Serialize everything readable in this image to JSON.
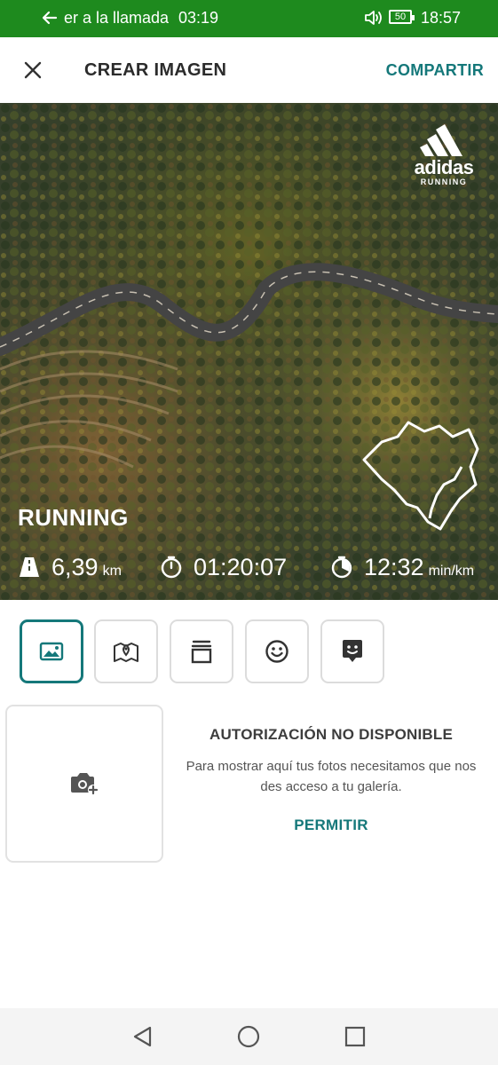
{
  "status_bar": {
    "call_text": "er a la llamada",
    "call_duration": "03:19",
    "battery": "50",
    "clock": "18:57",
    "icons": [
      "back-arrow-icon",
      "volume-icon",
      "battery-icon"
    ]
  },
  "header": {
    "title": "CREAR IMAGEN",
    "share_label": "COMPARTIR",
    "close_icon": "close-icon"
  },
  "preview": {
    "brand_name": "adidas",
    "brand_sub": "RUNNING",
    "sport": "RUNNING",
    "distance_value": "6,39",
    "distance_unit": "km",
    "duration_value": "01:20:07",
    "pace_value": "12:32",
    "pace_unit": "min/km"
  },
  "tools": [
    {
      "name": "image-tool",
      "icon": "image-icon",
      "active": true
    },
    {
      "name": "map-tool",
      "icon": "map-pin-icon",
      "active": false
    },
    {
      "name": "layers-tool",
      "icon": "layers-icon",
      "active": false
    },
    {
      "name": "emoji-tool",
      "icon": "smiley-icon",
      "active": false
    },
    {
      "name": "sticker-tool",
      "icon": "sticker-icon",
      "active": false
    }
  ],
  "permission": {
    "heading": "AUTORIZACIÓN NO DISPONIBLE",
    "body": "Para mostrar aquí tus fotos necesitamos que nos des acceso a tu galería.",
    "allow_label": "PERMITIR"
  },
  "colors": {
    "accent": "#15787a",
    "status_bar": "#1e8a1e"
  }
}
